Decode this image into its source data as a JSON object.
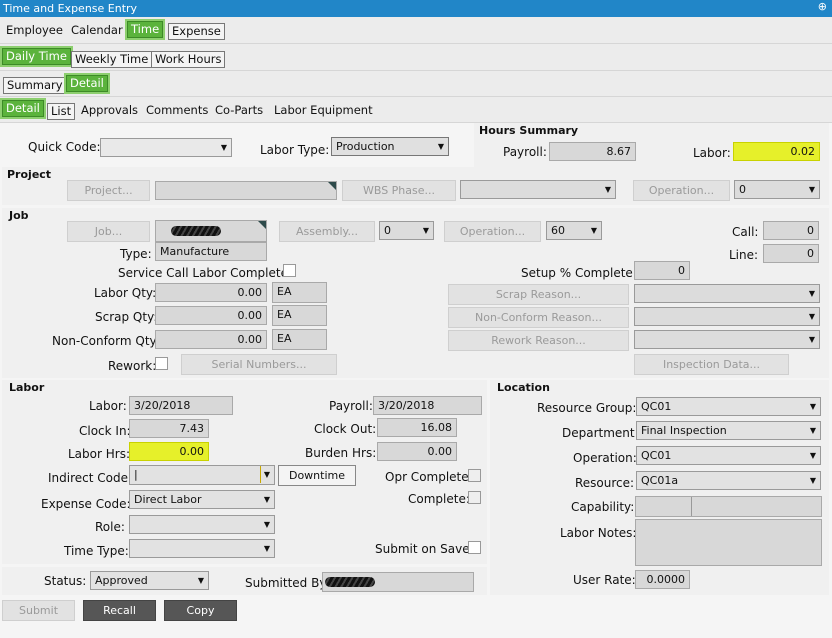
{
  "window": {
    "title": "Time and Expense Entry",
    "pin": "⊕"
  },
  "tabs1": [
    "Employee",
    "Calendar",
    "Time",
    "Expense"
  ],
  "tabs2": [
    "Daily Time",
    "Weekly Time",
    "Work Hours"
  ],
  "tabs3": [
    "Summary",
    "Detail"
  ],
  "tabs4": [
    "Detail",
    "List",
    "Approvals",
    "Comments",
    "Co-Parts",
    "Labor Equipment"
  ],
  "top": {
    "quick_code_label": "Quick Code:",
    "labor_type_label": "Labor Type:",
    "labor_type_value": "Production"
  },
  "hours_summary": {
    "title": "Hours Summary",
    "payroll_label": "Payroll:",
    "payroll_value": "8.67",
    "labor_label": "Labor:",
    "labor_value": "0.02"
  },
  "project": {
    "title": "Project",
    "project_btn": "Project...",
    "wbs_btn": "WBS Phase...",
    "operation_btn": "Operation...",
    "operation_value": "0"
  },
  "job": {
    "title": "Job",
    "job_btn": "Job...",
    "assembly_btn": "Assembly...",
    "assembly_value": "0",
    "operation_btn": "Operation...",
    "operation_value": "60",
    "call_label": "Call:",
    "call_value": "0",
    "line_label": "Line:",
    "line_value": "0",
    "type_label": "Type:",
    "type_value": "Manufacture",
    "service_call_label": "Service Call Labor Complete",
    "setup_label": "Setup % Complete:",
    "setup_value": "0",
    "labor_qty_label": "Labor Qty:",
    "labor_qty_value": "0.00",
    "labor_qty_uom": "EA",
    "scrap_qty_label": "Scrap Qty:",
    "scrap_qty_value": "0.00",
    "scrap_qty_uom": "EA",
    "nonconform_qty_label": "Non-Conform Qty:",
    "nonconform_qty_value": "0.00",
    "nonconform_qty_uom": "EA",
    "scrap_reason_btn": "Scrap Reason...",
    "nonconform_reason_btn": "Non-Conform Reason...",
    "rework_reason_btn": "Rework Reason...",
    "rework_label": "Rework:",
    "serial_btn": "Serial Numbers...",
    "inspection_btn": "Inspection Data..."
  },
  "labor": {
    "title": "Labor",
    "labor_label": "Labor:",
    "labor_value": "3/20/2018",
    "payroll_label": "Payroll:",
    "payroll_value": "3/20/2018",
    "clock_in_label": "Clock In:",
    "clock_in_value": "7.43",
    "clock_out_label": "Clock Out:",
    "clock_out_value": "16.08",
    "labor_hrs_label": "Labor Hrs:",
    "labor_hrs_value": "0.00",
    "burden_label": "Burden Hrs:",
    "burden_value": "0.00",
    "indirect_label": "Indirect Code:",
    "indirect_value": "|",
    "downtime_btn": "Downtime",
    "opr_complete_label": "Opr Complete:",
    "complete_label": "Complete:",
    "expense_label": "Expense Code:",
    "expense_value": "Direct Labor",
    "role_label": "Role:",
    "time_type_label": "Time Type:",
    "submit_on_save_label": "Submit on Save:"
  },
  "location": {
    "title": "Location",
    "resource_group_label": "Resource Group:",
    "resource_group_value": "QC01",
    "department_label": "Department:",
    "department_value": "Final Inspection",
    "operation_label": "Operation:",
    "operation_value": "QC01",
    "resource_label": "Resource:",
    "resource_value": "QC01a",
    "capability_label": "Capability:",
    "labor_notes_label": "Labor Notes:",
    "user_rate_label": "User Rate:",
    "user_rate_value": "0.0000"
  },
  "status": {
    "status_label": "Status:",
    "status_value": "Approved",
    "submitted_by_label": "Submitted By:"
  },
  "actions": {
    "submit": "Submit",
    "recall": "Recall",
    "copy": "Copy"
  }
}
